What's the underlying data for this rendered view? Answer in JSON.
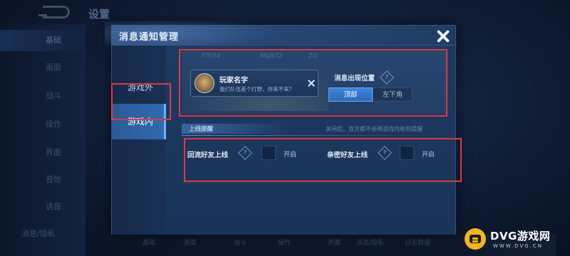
{
  "background": {
    "title": "设置",
    "sidebar_items": [
      "基础",
      "画面",
      "战斗",
      "操作",
      "界面",
      "音效",
      "语音",
      "消息/隐私"
    ],
    "preview_topstrip": [
      "FTO74",
      "88Z672",
      "ZO"
    ],
    "bottom_items": [
      "基础",
      "画面",
      "战斗",
      "操作",
      "界面",
      "消息/隐私",
      "日志数据"
    ]
  },
  "modal": {
    "title": "消息通知管理",
    "tabs": [
      {
        "label": "游戏外",
        "active": false
      },
      {
        "label": "游戏内",
        "active": true
      }
    ],
    "notification_preview": {
      "name": "玩家名字",
      "message": "我们队伍差个打野，你来不来？"
    },
    "position_setting": {
      "label": "消息出现位置",
      "options": [
        "顶部",
        "左下角"
      ],
      "selected": "顶部"
    },
    "section": {
      "title": "上线提醒",
      "note": "关闭后，双方都不会再游戏内收到提醒"
    },
    "toggles": [
      {
        "label": "回流好友上线",
        "state_text": "开启"
      },
      {
        "label": "亲密好友上线",
        "state_text": "开启"
      }
    ],
    "help_symbol": "?"
  },
  "watermark": {
    "name": "DVG游戏网",
    "sub": "WWW.DVG.CN"
  },
  "colors": {
    "accent": "#3e86da",
    "annotation": "#e0393e",
    "watermark_logo": "#f3b51b"
  }
}
